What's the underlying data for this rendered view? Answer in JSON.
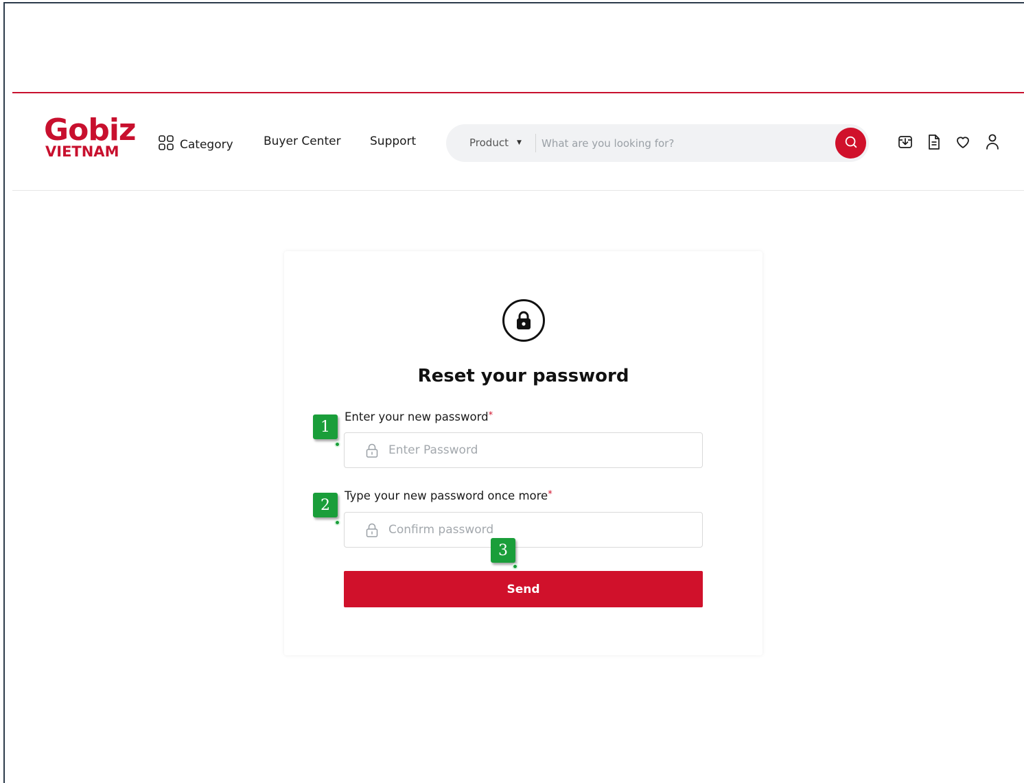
{
  "brand": {
    "logo_top": "Gobiz",
    "logo_bottom": "VIETNAM",
    "color": "#c8102e"
  },
  "nav": {
    "category": "Category",
    "buyer_center": "Buyer Center",
    "support": "Support"
  },
  "search": {
    "scope": "Product",
    "placeholder": "What are you looking for?"
  },
  "header_icons": [
    "download-box-icon",
    "document-icon",
    "heart-icon",
    "user-icon"
  ],
  "card": {
    "title": "Reset your password",
    "new_password_label": "Enter your new password",
    "new_password_placeholder": "Enter Password",
    "confirm_label": "Type your new password once more",
    "confirm_placeholder": "Confirm password",
    "required_mark": "*",
    "send_label": "Send"
  },
  "markers": [
    "1",
    "2",
    "3"
  ],
  "colors": {
    "accent": "#d0112b",
    "marker": "#1a9e3a"
  }
}
